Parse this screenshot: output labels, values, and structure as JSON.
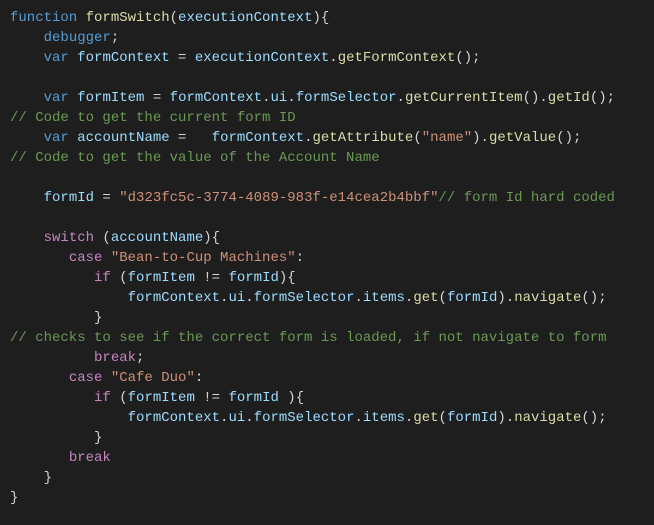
{
  "chart_data": null,
  "code": {
    "lines": [
      [
        {
          "cls": "tok-keyword",
          "t": "function"
        },
        {
          "cls": "tok-plain",
          "t": " "
        },
        {
          "cls": "tok-func",
          "t": "formSwitch"
        },
        {
          "cls": "tok-punct",
          "t": "("
        },
        {
          "cls": "tok-var",
          "t": "executionContext"
        },
        {
          "cls": "tok-punct",
          "t": "){"
        }
      ],
      [
        {
          "cls": "tok-plain",
          "t": "    "
        },
        {
          "cls": "tok-keyword",
          "t": "debugger"
        },
        {
          "cls": "tok-punct",
          "t": ";"
        }
      ],
      [
        {
          "cls": "tok-plain",
          "t": "    "
        },
        {
          "cls": "tok-keyword",
          "t": "var"
        },
        {
          "cls": "tok-plain",
          "t": " "
        },
        {
          "cls": "tok-var",
          "t": "formContext"
        },
        {
          "cls": "tok-plain",
          "t": " = "
        },
        {
          "cls": "tok-var",
          "t": "executionContext"
        },
        {
          "cls": "tok-punct",
          "t": "."
        },
        {
          "cls": "tok-func",
          "t": "getFormContext"
        },
        {
          "cls": "tok-punct",
          "t": "();"
        }
      ],
      [
        {
          "cls": "tok-plain",
          "t": " "
        }
      ],
      [
        {
          "cls": "tok-plain",
          "t": "    "
        },
        {
          "cls": "tok-keyword",
          "t": "var"
        },
        {
          "cls": "tok-plain",
          "t": " "
        },
        {
          "cls": "tok-var",
          "t": "formItem"
        },
        {
          "cls": "tok-plain",
          "t": " = "
        },
        {
          "cls": "tok-var",
          "t": "formContext"
        },
        {
          "cls": "tok-punct",
          "t": "."
        },
        {
          "cls": "tok-var",
          "t": "ui"
        },
        {
          "cls": "tok-punct",
          "t": "."
        },
        {
          "cls": "tok-var",
          "t": "formSelector"
        },
        {
          "cls": "tok-punct",
          "t": "."
        },
        {
          "cls": "tok-func",
          "t": "getCurrentItem"
        },
        {
          "cls": "tok-punct",
          "t": "()."
        },
        {
          "cls": "tok-func",
          "t": "getId"
        },
        {
          "cls": "tok-punct",
          "t": "();"
        }
      ],
      [
        {
          "cls": "tok-comment",
          "t": "// Code to get the current form ID"
        }
      ],
      [
        {
          "cls": "tok-plain",
          "t": "    "
        },
        {
          "cls": "tok-keyword",
          "t": "var"
        },
        {
          "cls": "tok-plain",
          "t": " "
        },
        {
          "cls": "tok-var",
          "t": "accountName"
        },
        {
          "cls": "tok-plain",
          "t": " =   "
        },
        {
          "cls": "tok-var",
          "t": "formContext"
        },
        {
          "cls": "tok-punct",
          "t": "."
        },
        {
          "cls": "tok-func",
          "t": "getAttribute"
        },
        {
          "cls": "tok-punct",
          "t": "("
        },
        {
          "cls": "tok-string",
          "t": "\"name\""
        },
        {
          "cls": "tok-punct",
          "t": ")."
        },
        {
          "cls": "tok-func",
          "t": "getValue"
        },
        {
          "cls": "tok-punct",
          "t": "();"
        }
      ],
      [
        {
          "cls": "tok-comment",
          "t": "// Code to get the value of the Account Name"
        }
      ],
      [
        {
          "cls": "tok-plain",
          "t": " "
        }
      ],
      [
        {
          "cls": "tok-plain",
          "t": "    "
        },
        {
          "cls": "tok-var",
          "t": "formId"
        },
        {
          "cls": "tok-plain",
          "t": " = "
        },
        {
          "cls": "tok-string",
          "t": "\"d323fc5c-3774-4089-983f-e14cea2b4bbf\""
        },
        {
          "cls": "tok-comment",
          "t": "// form Id hard coded"
        }
      ],
      [
        {
          "cls": "tok-plain",
          "t": " "
        }
      ],
      [
        {
          "cls": "tok-plain",
          "t": "    "
        },
        {
          "cls": "tok-control",
          "t": "switch"
        },
        {
          "cls": "tok-plain",
          "t": " ("
        },
        {
          "cls": "tok-var",
          "t": "accountName"
        },
        {
          "cls": "tok-punct",
          "t": "){"
        }
      ],
      [
        {
          "cls": "tok-plain",
          "t": "       "
        },
        {
          "cls": "tok-control",
          "t": "case"
        },
        {
          "cls": "tok-plain",
          "t": " "
        },
        {
          "cls": "tok-string",
          "t": "\"Bean-to-Cup Machines\""
        },
        {
          "cls": "tok-punct",
          "t": ":"
        }
      ],
      [
        {
          "cls": "tok-plain",
          "t": "          "
        },
        {
          "cls": "tok-control",
          "t": "if"
        },
        {
          "cls": "tok-plain",
          "t": " ("
        },
        {
          "cls": "tok-var",
          "t": "formItem"
        },
        {
          "cls": "tok-plain",
          "t": " != "
        },
        {
          "cls": "tok-var",
          "t": "formId"
        },
        {
          "cls": "tok-punct",
          "t": "){"
        }
      ],
      [
        {
          "cls": "tok-plain",
          "t": "              "
        },
        {
          "cls": "tok-var",
          "t": "formContext"
        },
        {
          "cls": "tok-punct",
          "t": "."
        },
        {
          "cls": "tok-var",
          "t": "ui"
        },
        {
          "cls": "tok-punct",
          "t": "."
        },
        {
          "cls": "tok-var",
          "t": "formSelector"
        },
        {
          "cls": "tok-punct",
          "t": "."
        },
        {
          "cls": "tok-var",
          "t": "items"
        },
        {
          "cls": "tok-punct",
          "t": "."
        },
        {
          "cls": "tok-func",
          "t": "get"
        },
        {
          "cls": "tok-punct",
          "t": "("
        },
        {
          "cls": "tok-var",
          "t": "formId"
        },
        {
          "cls": "tok-punct",
          "t": ")."
        },
        {
          "cls": "tok-func",
          "t": "navigate"
        },
        {
          "cls": "tok-punct",
          "t": "();"
        }
      ],
      [
        {
          "cls": "tok-plain",
          "t": "          "
        },
        {
          "cls": "tok-punct",
          "t": "}"
        }
      ],
      [
        {
          "cls": "tok-comment",
          "t": "// checks to see if the correct form is loaded, if not navigate to form"
        }
      ],
      [
        {
          "cls": "tok-plain",
          "t": "          "
        },
        {
          "cls": "tok-control",
          "t": "break"
        },
        {
          "cls": "tok-punct",
          "t": ";"
        }
      ],
      [
        {
          "cls": "tok-plain",
          "t": "       "
        },
        {
          "cls": "tok-control",
          "t": "case"
        },
        {
          "cls": "tok-plain",
          "t": " "
        },
        {
          "cls": "tok-string",
          "t": "\"Cafe Duo\""
        },
        {
          "cls": "tok-punct",
          "t": ":"
        }
      ],
      [
        {
          "cls": "tok-plain",
          "t": "          "
        },
        {
          "cls": "tok-control",
          "t": "if"
        },
        {
          "cls": "tok-plain",
          "t": " ("
        },
        {
          "cls": "tok-var",
          "t": "formItem"
        },
        {
          "cls": "tok-plain",
          "t": " != "
        },
        {
          "cls": "tok-var",
          "t": "formId"
        },
        {
          "cls": "tok-plain",
          "t": " ){"
        }
      ],
      [
        {
          "cls": "tok-plain",
          "t": "              "
        },
        {
          "cls": "tok-var",
          "t": "formContext"
        },
        {
          "cls": "tok-punct",
          "t": "."
        },
        {
          "cls": "tok-var",
          "t": "ui"
        },
        {
          "cls": "tok-punct",
          "t": "."
        },
        {
          "cls": "tok-var",
          "t": "formSelector"
        },
        {
          "cls": "tok-punct",
          "t": "."
        },
        {
          "cls": "tok-var",
          "t": "items"
        },
        {
          "cls": "tok-punct",
          "t": "."
        },
        {
          "cls": "tok-func",
          "t": "get"
        },
        {
          "cls": "tok-punct",
          "t": "("
        },
        {
          "cls": "tok-var",
          "t": "formId"
        },
        {
          "cls": "tok-punct",
          "t": ")."
        },
        {
          "cls": "tok-func",
          "t": "navigate"
        },
        {
          "cls": "tok-punct",
          "t": "();"
        }
      ],
      [
        {
          "cls": "tok-plain",
          "t": "          "
        },
        {
          "cls": "tok-punct",
          "t": "}"
        }
      ],
      [
        {
          "cls": "tok-plain",
          "t": "       "
        },
        {
          "cls": "tok-control",
          "t": "break"
        }
      ],
      [
        {
          "cls": "tok-plain",
          "t": "    "
        },
        {
          "cls": "tok-punct",
          "t": "}"
        }
      ],
      [
        {
          "cls": "tok-punct",
          "t": "}"
        }
      ]
    ]
  }
}
